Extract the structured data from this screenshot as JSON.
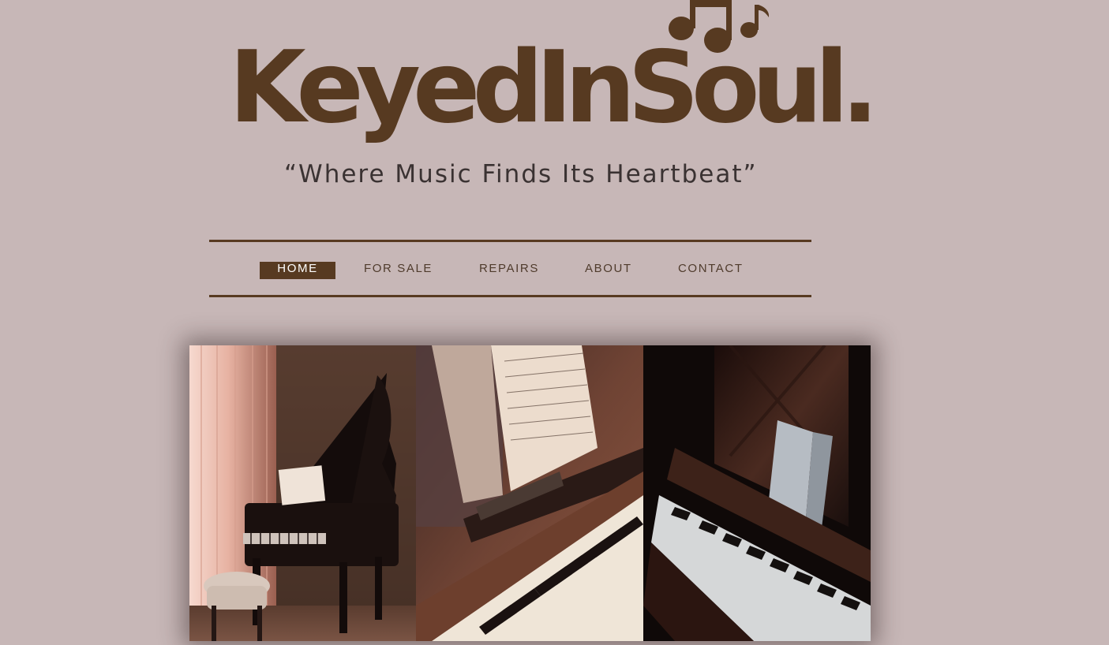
{
  "logo": {
    "wordmark": "KeyedInSoul.",
    "tagline": "“Where Music Finds Its Heartbeat”",
    "icon": "music-notes-icon",
    "colors": {
      "brand": "#573a21",
      "tagline": "#3a3232"
    }
  },
  "nav": {
    "items": [
      {
        "label": "HOME",
        "active": true
      },
      {
        "label": "FOR SALE",
        "active": false
      },
      {
        "label": "REPAIRS",
        "active": false
      },
      {
        "label": "ABOUT",
        "active": false
      },
      {
        "label": "CONTACT",
        "active": false
      }
    ]
  },
  "gallery": {
    "images": [
      {
        "name": "grand-piano-photo"
      },
      {
        "name": "upright-piano-sheet-music-photo"
      },
      {
        "name": "dark-piano-keys-photo"
      }
    ]
  },
  "theme": {
    "background": "#c7b7b7",
    "accent": "#573a21",
    "nav_text": "#4f3b2c"
  }
}
